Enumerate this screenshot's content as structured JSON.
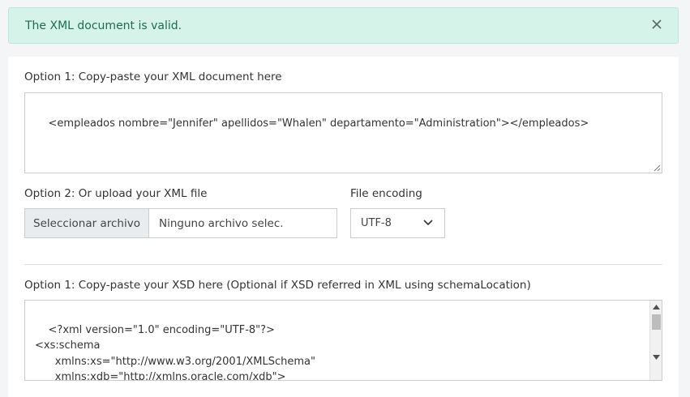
{
  "alert": {
    "message": "The XML document is valid."
  },
  "xml_section": {
    "option1_label": "Option 1: Copy-paste your XML document here",
    "xml_content": "<empleados nombre=\"Jennifer\" apellidos=\"Whalen\" departamento=\"Administration\"></empleados>",
    "option2_label": "Option 2: Or upload your XML file",
    "file_button": "Seleccionar archivo",
    "file_name": "Ninguno archivo selec.",
    "encoding_label": "File encoding",
    "encoding_value": "UTF-8"
  },
  "xsd_section": {
    "option1_label": "Option 1: Copy-paste your XSD here (Optional if XSD referred in XML using schemaLocation)",
    "xsd_content": "<?xml version=\"1.0\" encoding=\"UTF-8\"?>\n<xs:schema\n      xmlns:xs=\"http://www.w3.org/2001/XMLSchema\"\n      xmlns:xdb=\"http://xmlns.oracle.com/xdb\">\n      <xs:element name=\"empleados\">"
  }
}
